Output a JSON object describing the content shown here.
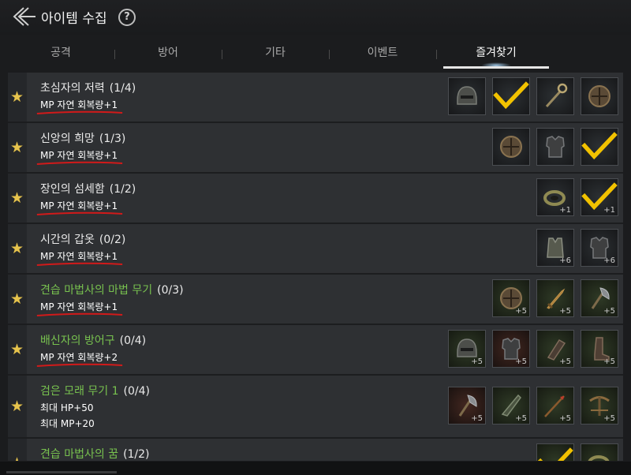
{
  "header": {
    "title": "아이템 수집",
    "back_icon": "back-arrow-icon",
    "help_symbol": "?"
  },
  "tabs": [
    {
      "label": "공격",
      "active": false
    },
    {
      "label": "방어",
      "active": false
    },
    {
      "label": "기타",
      "active": false
    },
    {
      "label": "이벤트",
      "active": false
    },
    {
      "label": "즐겨찾기",
      "active": true
    }
  ],
  "colors": {
    "star": "#e6c34c",
    "green_title": "#78c24f",
    "underline": "#d11a1a",
    "check": "#f2c200"
  },
  "collections": [
    {
      "title": "초심자의 저력",
      "count": "(1/4)",
      "green": false,
      "effects": [
        "MP 자연 회복량+1"
      ],
      "slots": [
        {
          "icon": "helmet-icon",
          "bg": "dark",
          "plus": "",
          "checked": false
        },
        {
          "icon": "",
          "bg": "dark",
          "plus": "",
          "checked": true
        },
        {
          "icon": "staff-icon",
          "bg": "dark",
          "plus": "",
          "checked": false
        },
        {
          "icon": "shield-icon",
          "bg": "dark",
          "plus": "",
          "checked": false
        }
      ]
    },
    {
      "title": "신앙의 희망",
      "count": "(1/3)",
      "green": false,
      "effects": [
        "MP 자연 회복량+1"
      ],
      "slots": [
        {
          "icon": "shield-icon",
          "bg": "dark",
          "plus": "",
          "checked": false
        },
        {
          "icon": "armor-icon",
          "bg": "dark",
          "plus": "",
          "checked": false
        },
        {
          "icon": "",
          "bg": "dark",
          "plus": "",
          "checked": true
        }
      ]
    },
    {
      "title": "장인의 섬세함",
      "count": "(1/2)",
      "green": false,
      "effects": [
        "MP 자연 회복량+1"
      ],
      "slots": [
        {
          "icon": "ring-icon",
          "bg": "dark",
          "plus": "+1",
          "checked": false
        },
        {
          "icon": "",
          "bg": "dark",
          "plus": "+1",
          "checked": true
        }
      ]
    },
    {
      "title": "시간의 갑옷",
      "count": "(0/2)",
      "green": false,
      "effects": [
        "MP 자연 회복량+1"
      ],
      "slots": [
        {
          "icon": "vest-icon",
          "bg": "dark",
          "plus": "+6",
          "checked": false
        },
        {
          "icon": "armor-icon",
          "bg": "dark",
          "plus": "+6",
          "checked": false
        }
      ]
    },
    {
      "title": "견습 마법사의 마법 무기",
      "count": "(0/3)",
      "green": true,
      "effects": [
        "MP 자연 회복량+1"
      ],
      "slots": [
        {
          "icon": "shield-icon",
          "bg": "green",
          "plus": "+5",
          "checked": false
        },
        {
          "icon": "dagger-icon",
          "bg": "green",
          "plus": "+5",
          "checked": false
        },
        {
          "icon": "axe-icon",
          "bg": "green",
          "plus": "+5",
          "checked": false
        }
      ]
    },
    {
      "title": "배신자의 방어구",
      "count": "(0/4)",
      "green": true,
      "effects": [
        "MP 자연 회복량+2"
      ],
      "slots": [
        {
          "icon": "helmet-icon",
          "bg": "green",
          "plus": "+5",
          "checked": false
        },
        {
          "icon": "armor-icon",
          "bg": "red",
          "plus": "+5",
          "checked": false
        },
        {
          "icon": "gauntlet-icon",
          "bg": "green",
          "plus": "+5",
          "checked": false
        },
        {
          "icon": "boots-icon",
          "bg": "green",
          "plus": "+5",
          "checked": false
        }
      ]
    },
    {
      "title": "검은 모래 무기 1",
      "count": "(0/4)",
      "green": true,
      "effects": [
        "최대 HP+50",
        "최대 MP+20"
      ],
      "slots": [
        {
          "icon": "axe-icon",
          "bg": "red",
          "plus": "+5",
          "checked": false
        },
        {
          "icon": "blade-icon",
          "bg": "green",
          "plus": "+5",
          "checked": false
        },
        {
          "icon": "spear-icon",
          "bg": "green",
          "plus": "+5",
          "checked": false
        },
        {
          "icon": "crossbow-icon",
          "bg": "green",
          "plus": "+5",
          "checked": false
        }
      ]
    },
    {
      "title": "견습 마법사의 꿈",
      "count": "(1/2)",
      "green": true,
      "effects": [],
      "slots": [
        {
          "icon": "",
          "bg": "green",
          "plus": "",
          "checked": true
        },
        {
          "icon": "ring-icon",
          "bg": "green",
          "plus": "",
          "checked": false
        }
      ]
    }
  ]
}
